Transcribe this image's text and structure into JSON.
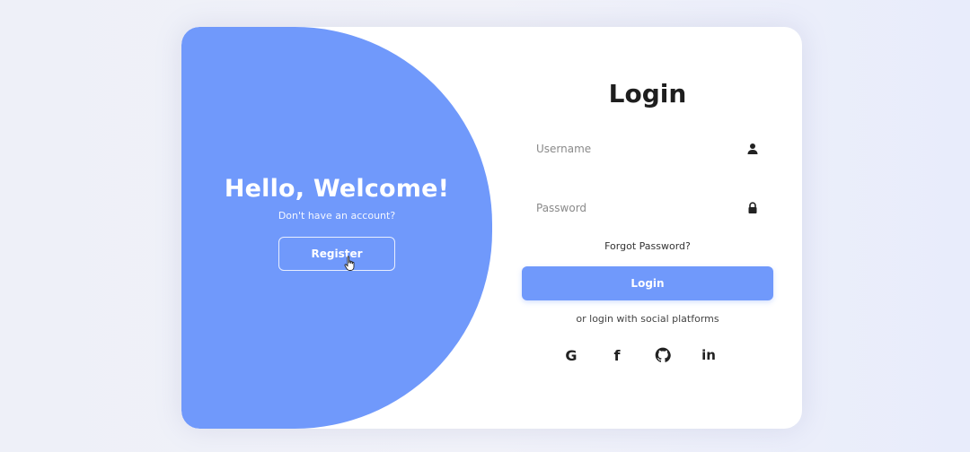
{
  "welcome": {
    "title": "Hello, Welcome!",
    "subtitle": "Don't have an account?",
    "register_label": "Register"
  },
  "login": {
    "title": "Login",
    "username_placeholder": "Username",
    "password_placeholder": "Password",
    "forgot_label": "Forgot Password?",
    "login_label": "Login",
    "social_text": "or login with social platforms",
    "socials": [
      {
        "icon": "google-icon",
        "glyph": "G"
      },
      {
        "icon": "facebook-icon",
        "glyph": "f"
      },
      {
        "icon": "github-icon",
        "glyph": ""
      },
      {
        "icon": "linkedin-icon",
        "glyph": "in"
      }
    ]
  },
  "colors": {
    "accent": "#7099fb",
    "card": "#ffffff",
    "text": "#1e1e1e"
  }
}
